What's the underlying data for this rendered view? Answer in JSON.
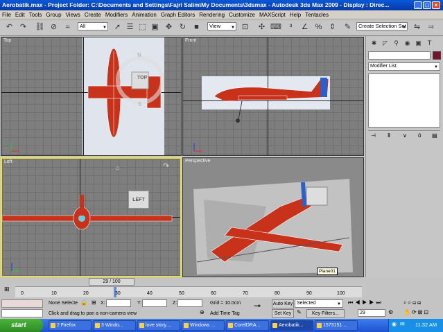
{
  "window": {
    "title": "Aerobatik.max  - Project Folder: C:\\Documents and Settings\\Fajri Salim\\My Documents\\3dsmax  - Autodesk 3ds Max  2009    - Display : Direc..."
  },
  "menubar": {
    "items": [
      "File",
      "Edit",
      "Tools",
      "Group",
      "Views",
      "Create",
      "Modifiers",
      "Animation",
      "Graph Editors",
      "Rendering",
      "Customize",
      "MAXScript",
      "Help",
      "Tentacles"
    ]
  },
  "toolbar": {
    "selection_filter": "All",
    "reference_coord": "View",
    "named_selection_placeholder": "Create Selection Set"
  },
  "viewports": {
    "top": {
      "label": "Top",
      "cube_label": "TOP",
      "compass": [
        "N",
        "S"
      ]
    },
    "front": {
      "label": "Front"
    },
    "left": {
      "label": "Left",
      "cube_label": "LEFT"
    },
    "perspective": {
      "label": "Perspective",
      "tooltip": "Plane01"
    }
  },
  "command_panel": {
    "modifier_list": "Modifier List"
  },
  "timeline": {
    "slider_label": "29 / 100",
    "ticks": [
      "0",
      "10",
      "20",
      "30",
      "40",
      "50",
      "60",
      "70",
      "80",
      "90",
      "100"
    ]
  },
  "status": {
    "selection": "None Selecte",
    "x_label": "X:",
    "y_label": "Y:",
    "z_label": "Z:",
    "grid": "Grid = 10.0cm",
    "prompt": "Click and drag to pan a non-camera view",
    "add_time_tag": "Add Time Tag",
    "auto_key": "Auto Key",
    "set_key": "Set Key",
    "selected": "Selected",
    "key_filters": "Key Filters...",
    "frame": "29"
  },
  "taskbar": {
    "start": "start",
    "tasks": [
      "2 Firefox",
      "3 Windo...",
      "love story....",
      "Windows ...",
      "CorelDRA...",
      "Aerobatik...",
      "1573151 ..."
    ],
    "clock": "11:32 AM"
  },
  "colors": {
    "title_blue": "#0a58d8",
    "start_green": "#3c9a2c",
    "active_viewport": "#e8e048",
    "plane_red": "#c8321a",
    "color_swatch": "#7a1030"
  }
}
